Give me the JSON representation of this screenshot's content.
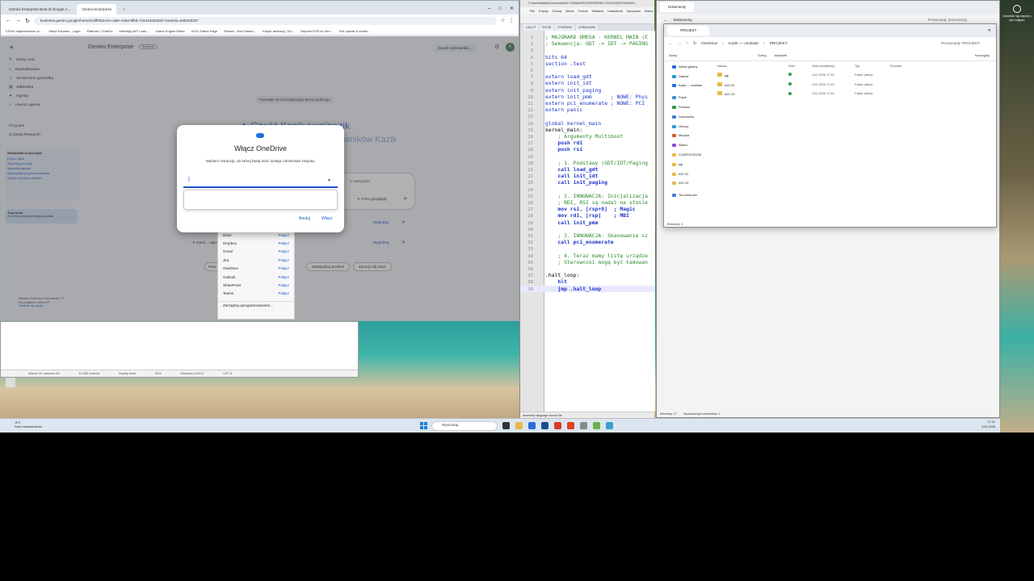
{
  "browser": {
    "tabs": [
      "Gemini Enterprise Best of Google A...",
      "Gemini Enterprise"
    ],
    "url": "business.gemini.google/home/cid/ff452ce2-ca8e-4484-9fbd-7344164520dc?csesidx=638225307",
    "bookmarks": [
      "CFMG Najmaniaczer pr...",
      "Stripe Express - Login",
      "Platform | ChatGo",
      "Interfejsy API i usłu...",
      "Game Engine Editor",
      "KICK Status Page",
      "Stream - Kick Dasho...",
      "Edytor animacji | Do...",
      "Deposit FUN on Sim...",
      "File upload & sharin..."
    ]
  },
  "gemini": {
    "brand": "Gemini Enterprise",
    "brand_badge": "Business",
    "top_right": "Zespół użytkownika...",
    "avatar": "K",
    "sidebar": {
      "items": [
        "Nowy czat",
        "Wyszukiwanie",
        "Oznaczone gwiazdką",
        "Biblioteka",
        "Agenty",
        "Utwórz agenta"
      ],
      "recent_header": "Przypięte",
      "recent_item": "Deep Research"
    },
    "trial_banner": "Pozostało 38 dni bezpłatnego okresu próbnego",
    "greeting_part1": "Cześć Kazik seminazik",
    "greeting_part2": "owników Kazik",
    "promo": {
      "title": "Wskazówki na początek",
      "rows": [
        "Połącz dane",
        "Wypróbuj prompty",
        "Wypróbuj agenta",
        "Spersonalizuj sposób działania",
        "Zaproś członków zespołu"
      ]
    },
    "upgrade": {
      "title": "Kup teraz",
      "subtitle": "Do końca okresu próbnego pozostało"
    },
    "user_footer": {
      "name": "Warsaw, Masovian Voivodeship, PL",
      "ip": "Na podstawie adresu IP",
      "update": "Dowiedz się więcej"
    },
    "prompt_hint": "o narzędzia",
    "model": "3 Pro (podgląd)",
    "try_button_1": "Wypróbuj",
    "try_button_2": "Wypróbuj",
    "suggestion": "Gemi... najinteligentniejszy model do tej pory",
    "chips": [
      "Pron...",
      "Zaaktualizuj przełom",
      "Zacznij mój dzień"
    ]
  },
  "dialog": {
    "title": "Włącz OneDrive",
    "description": "Wybierz instancję, do której będą mieć dostęp członkowie zespołu.",
    "input_value": "",
    "cancel": "Anuluj",
    "confirm": "Włącz"
  },
  "connectors": {
    "items": [
      {
        "name": "Drive",
        "action": "Połącz"
      },
      {
        "name": "Dropbox",
        "action": "Połącz"
      },
      {
        "name": "Gmail",
        "action": "Połącz"
      },
      {
        "name": "Jira",
        "action": "Połącz"
      },
      {
        "name": "OneDrive",
        "action": "Połącz"
      },
      {
        "name": "Outlook",
        "action": "Połącz"
      },
      {
        "name": "SharePoint",
        "action": "Połącz"
      },
      {
        "name": "Teams",
        "action": "Połącz"
      }
    ],
    "manage": "Zarządzaj oprogramowaniem..."
  },
  "notepad": {
    "status": [
      "Wiersz 16, kolumna 45",
      "10 385 znaków",
      "Zwykły tekst",
      "90%",
      "Windows (CRLF)",
      "UTF-8"
    ]
  },
  "npp": {
    "title": "C:\\Users\\kazik\\Documents\\AGI V2\\MAIN\\ROZSZERZENIE OS-DODATKOWA\\MAI...",
    "menu": [
      "Plik",
      "Edycja",
      "Szukaj",
      "Widok",
      "Format",
      "Składnia",
      "Ustawienia",
      "Narzędzia",
      "Makra"
    ],
    "tabs": [
      "CALLVT",
      "ENTER",
      "ETHERENV",
      "KERNELASM"
    ],
    "status": "Assembly language source file",
    "lines": [
      {
        "n": "1",
        "t": "; MAJORARD OMEGA - KERNEL MAIN (E",
        "c": "c-cm"
      },
      {
        "n": "2",
        "t": "; Sekwencja: GDT -> IDT -> PAGING",
        "c": "c-cm"
      },
      {
        "n": "3",
        "t": "",
        "c": "c-bl"
      },
      {
        "n": "4",
        "t": "bits 64",
        "c": "c-kw"
      },
      {
        "n": "5",
        "t": "section .text",
        "c": "c-kw"
      },
      {
        "n": "6",
        "t": "",
        "c": "c-bl"
      },
      {
        "n": "7",
        "t": "extern load_gdt",
        "c": "c-kw"
      },
      {
        "n": "8",
        "t": "extern init_idt",
        "c": "c-kw"
      },
      {
        "n": "9",
        "t": "extern init_paging",
        "c": "c-kw"
      },
      {
        "n": "10",
        "t": "extern init_pmm      ; NOWE: Phys",
        "c": "c-kw"
      },
      {
        "n": "11",
        "t": "extern pci_enumerate ; NOWE: PCI",
        "c": "c-kw"
      },
      {
        "n": "12",
        "t": "extern panic",
        "c": "c-kw"
      },
      {
        "n": "13",
        "t": "",
        "c": "c-bl"
      },
      {
        "n": "14",
        "t": "global kernel_main",
        "c": "c-kw"
      },
      {
        "n": "15",
        "t": "kernel_main:",
        "c": "c-bl"
      },
      {
        "n": "16",
        "t": "    ; Argumenty Multiboot",
        "c": "c-cm"
      },
      {
        "n": "17",
        "t": "    push rdi",
        "c": "c-ins"
      },
      {
        "n": "18",
        "t": "    push rsi",
        "c": "c-ins"
      },
      {
        "n": "19",
        "t": "",
        "c": "c-bl"
      },
      {
        "n": "20",
        "t": "    ; 1. Podstawy (GDT/IDT/Paging",
        "c": "c-cm"
      },
      {
        "n": "21",
        "t": "    call load_gdt",
        "c": "c-ins"
      },
      {
        "n": "22",
        "t": "    call init_idt",
        "c": "c-ins"
      },
      {
        "n": "23",
        "t": "    call init_paging",
        "c": "c-ins"
      },
      {
        "n": "24",
        "t": "",
        "c": "c-bl"
      },
      {
        "n": "25",
        "t": "    ; 2. INNOWACJA: Inicjalizacja",
        "c": "c-cm"
      },
      {
        "n": "26",
        "t": "    ; RDI, RSI są nadal na stosie",
        "c": "c-cm"
      },
      {
        "n": "27",
        "t": "    mov rsi, [rsp+8]  ; Magic",
        "c": "c-ins"
      },
      {
        "n": "28",
        "t": "    mov rdi, [rsp]    ; MBI",
        "c": "c-ins"
      },
      {
        "n": "29",
        "t": "    call init_pmm",
        "c": "c-ins"
      },
      {
        "n": "30",
        "t": "",
        "c": "c-bl"
      },
      {
        "n": "31",
        "t": "    ; 3. INNOWACJA: Skanowanie sz",
        "c": "c-cm"
      },
      {
        "n": "32",
        "t": "    call pci_enumerate",
        "c": "c-ins"
      },
      {
        "n": "33",
        "t": "",
        "c": "c-bl"
      },
      {
        "n": "34",
        "t": "    ; 4. Teraz mamy listę urządze",
        "c": "c-cm"
      },
      {
        "n": "35",
        "t": "    ; Sterowniki mogą być ładowan",
        "c": "c-cm"
      },
      {
        "n": "36",
        "t": "",
        "c": "c-bl"
      },
      {
        "n": "37",
        "t": ".halt_loop:",
        "c": "c-bl"
      },
      {
        "n": "38",
        "t": "    hlt",
        "c": "c-ins"
      },
      {
        "n": "39",
        "t": "    jmp .halt_loop",
        "c": "c-ins"
      }
    ]
  },
  "explorer_back": {
    "tab": "Dokumenty",
    "breadcrumb": "Dokumenty",
    "search": "Przeszukaj: Dokumenty",
    "status": "Elementy: 17",
    "selected": "Zaznaczonych elementów: 3"
  },
  "explorer": {
    "tab": "PROJEKT",
    "breadcrumb": [
      "OneDrive",
      "Kazik — osobiste",
      "PROJEKT"
    ],
    "search": "Przeszukaj: PROJEKT",
    "tools": [
      "Nowy",
      "Sortuj",
      "Wyświetl"
    ],
    "details": "Szczegóły",
    "sidebar": [
      "Widok główny",
      "Galeria",
      "Kazik — osobiste",
      "Pulpit",
      "Pobrane",
      "Dokumenty",
      "Obrazy",
      "Muzyka",
      "Wideo",
      "COURSCODGM",
      "agi",
      "AGI V2",
      "AGI V3",
      "Ten komputer"
    ],
    "columns": [
      "Nazwa",
      "Stan",
      "Data modyfikacji",
      "Typ",
      "Rozmiar"
    ],
    "rows": [
      {
        "name": "agi",
        "date": "4.02.2026 17:20",
        "type": "Folder plików"
      },
      {
        "name": "AGI V2",
        "date": "4.02.2026 17:20",
        "type": "Folder plików"
      },
      {
        "name": "AGI V3",
        "date": "4.02.2026 17:20",
        "type": "Folder plików"
      }
    ],
    "status": "Elementy: 3"
  },
  "taskbar": {
    "weather_temp": "-8°C",
    "weather_desc": "Dużo zachmurzenia",
    "search": "Wyszukaj",
    "time": "17:21",
    "date": "4.02.2026"
  },
  "desktop": {
    "notification": "Dowiedz się więcej o tym zdjęciu"
  }
}
